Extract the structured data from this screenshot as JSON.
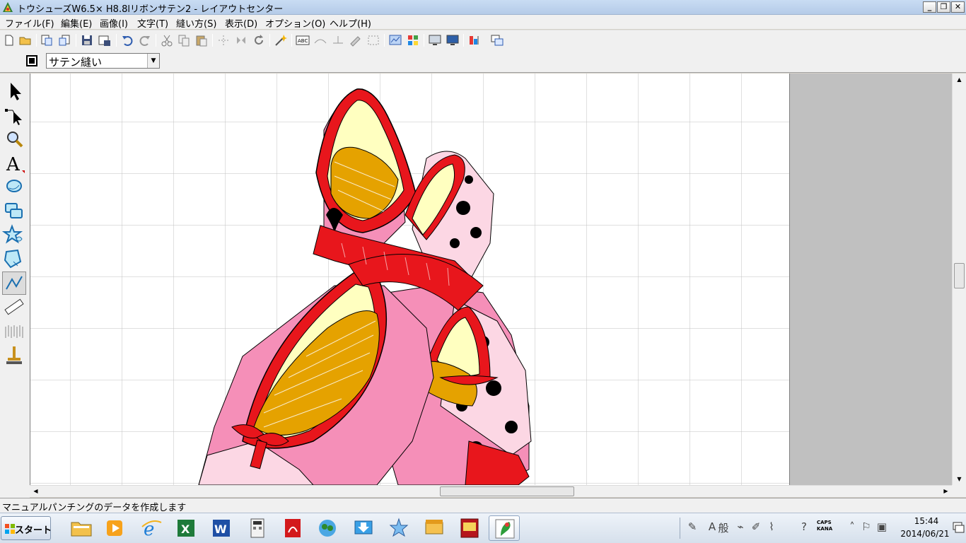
{
  "window": {
    "title": "トウシューズW6.5× H8.8lリボンサテン2 - レイアウトセンター"
  },
  "menu": [
    "ファイル(F)",
    "編集(E)",
    "画像(I)",
    "文字(T)",
    "縫い方(S)",
    "表示(D)",
    "オプション(O)",
    "ヘルプ(H)"
  ],
  "stitch": {
    "selected": "サテン縫い"
  },
  "status": {
    "message": "マニュアルパンチングのデータを作成します"
  },
  "taskbar": {
    "start_label": "スタート",
    "ime": {
      "input_mode": "A",
      "kanji_mode": "般",
      "caps": "CAPS",
      "kana": "KANA"
    },
    "clock": {
      "time": "15:44",
      "date": "2014/06/21"
    }
  },
  "colors": {
    "ribbon_red": "#e8161c",
    "pale_yellow": "#ffffc0",
    "sole_gold": "#e5a200",
    "pink": "#f58fb8",
    "light_pink": "#fcd7e4",
    "grid": "#c0c0c0"
  }
}
